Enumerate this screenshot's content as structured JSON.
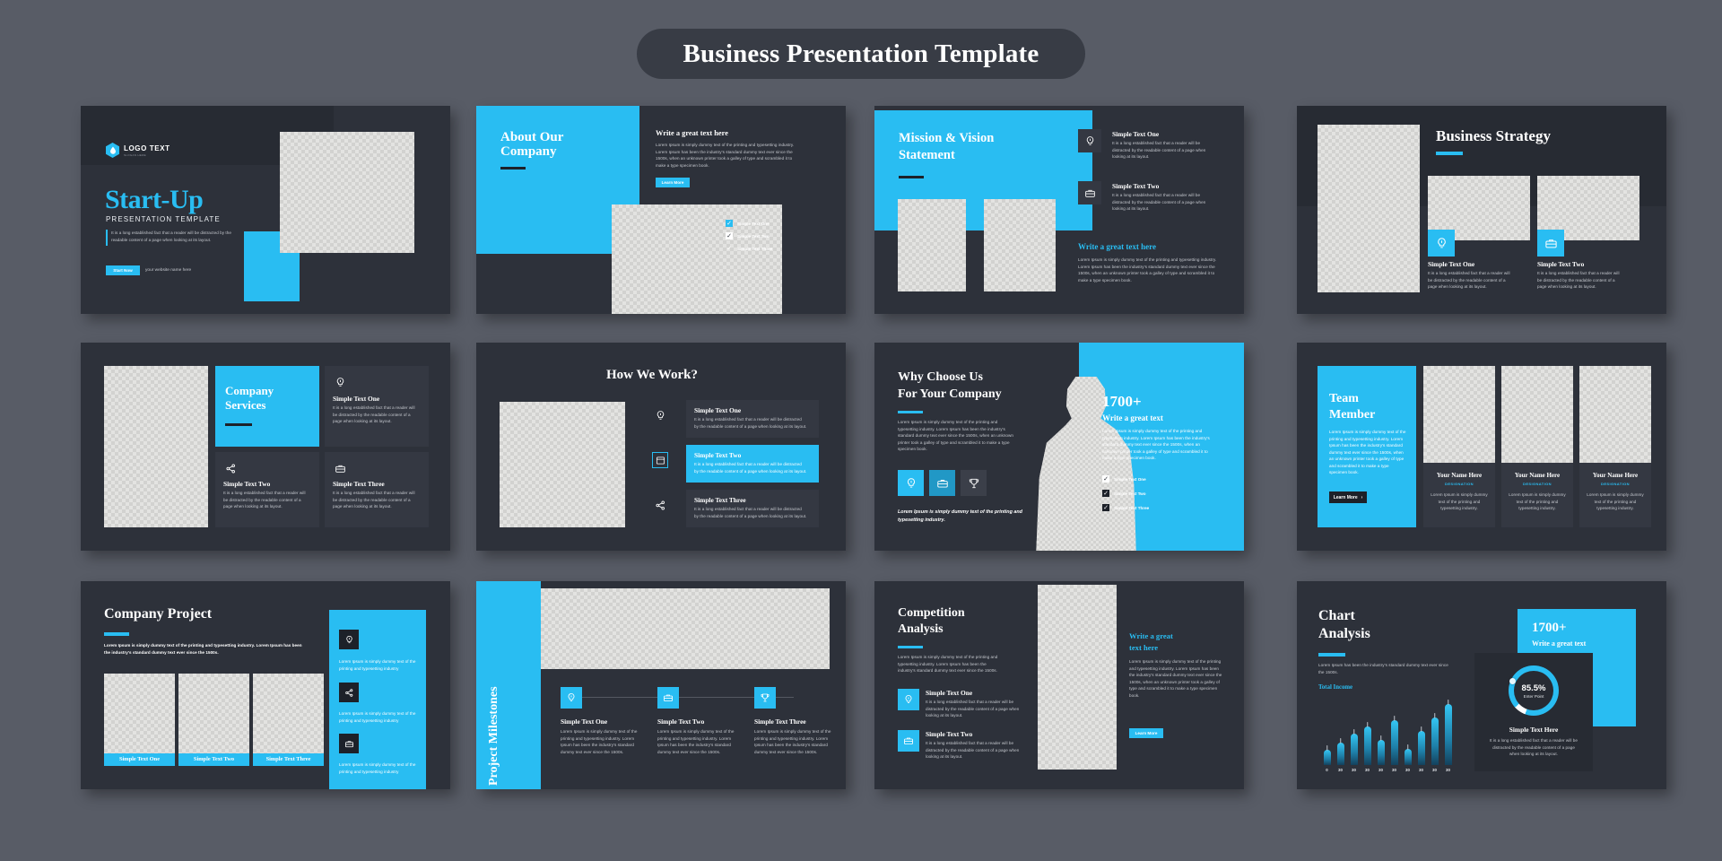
{
  "header": {
    "title": "Business Presentation Template"
  },
  "theme": {
    "accent": "#29bdf2",
    "slide_bg": "#2d313a",
    "page_bg": "#585c66",
    "panel": "#343842",
    "dark": "#1d2129"
  },
  "common": {
    "body_short": "It is a long established fact that a reader will be distracted by the readable content of a page when looking at its layout.",
    "lorem_long": "Lorem Ipsum is simply dummy text of the printing and typesetting industry. Lorem Ipsum has been the industry's standard dummy text ever since the 1500s, when an unknown printer took a galley of type and scrambled it to make a type specimen book.",
    "lorem_med": "Lorem Ipsum is simply dummy text of the printing and typesetting industry. Lorem Ipsum has been the industry's standard dummy text ever since the 1500s.",
    "lorem_tiny": "Lorem Ipsum is simply dummy text of the printing and typesetting industry.",
    "lorem_card": "Lorem Ipsum is simply dummy text of the printing and typesetting industry."
  },
  "slides": [
    {
      "id": "start-up",
      "logo_text": "LOGO TEXT",
      "logo_sub": "SLOGAN HERE",
      "title": "Start-Up",
      "subtitle": "PRESENTATION TEMPLATE",
      "body": "It is a long established fact that a reader will be distracted by the readable content of a page when looking at its layout.",
      "button": "Start Now",
      "website": "your website name here"
    },
    {
      "id": "about-our-company",
      "title_line1": "About Our",
      "title_line2": "Company",
      "right_title": "Write a great text here",
      "right_body": "Lorem Ipsum is simply dummy text of the printing and typesetting industry. Lorem Ipsum has been the industry's standard dummy text ever since the 1500s, when an unknown printer took a galley of type and scrambled it to make a type specimen book.",
      "button": "Learn More",
      "checks": [
        {
          "label": "Simple Text One",
          "state": "accent"
        },
        {
          "label": "Simple Text Two",
          "state": "white"
        },
        {
          "label": "Simple Text Three",
          "state": "plain"
        }
      ]
    },
    {
      "id": "mission-vision",
      "title_line1": "Mission & Vision",
      "title_line2": "Statement",
      "items": [
        {
          "icon": "lightbulb-icon",
          "heading": "Simple Text One",
          "body": "It is a long established fact that a reader will be distracted by the readable content of a page when looking at its layout."
        },
        {
          "icon": "briefcase-icon",
          "heading": "Simple Text Two",
          "body": "It is a long established fact that a reader will be distracted by the readable content of a page when looking at its layout."
        }
      ],
      "bottom_title": "Write a great text here",
      "bottom_body": "Lorem Ipsum is simply dummy text of the printing and typesetting industry. Lorem Ipsum has been the industry's standard dummy text ever since the 1500s, when an unknown printer took a galley of type and scrambled it to make a type specimen book."
    },
    {
      "id": "business-strategy",
      "title": "Business Strategy",
      "cards": [
        {
          "icon": "lightbulb-icon",
          "heading": "Simple Text One",
          "body": "It is a long established fact that a reader will be distracted by the readable content of a page when looking at its layout."
        },
        {
          "icon": "briefcase-icon",
          "heading": "Simple Text Two",
          "body": "It is a long established fact that a reader will be distracted by the readable content of a page when looking at its layout."
        }
      ]
    },
    {
      "id": "company-services",
      "title_line1": "Company",
      "title_line2": "Services",
      "cards": [
        {
          "icon": "lightbulb-icon",
          "heading": "Simple Text One",
          "body": "It is a long established fact that a reader will be distracted by the readable content of a page when looking at its layout."
        },
        {
          "icon": "share-icon",
          "heading": "Simple Text Two",
          "body": "It is a long established fact that a reader will be distracted by the readable content of a page when looking at its layout."
        },
        {
          "icon": "briefcase-icon",
          "heading": "Simple Text Three",
          "body": "It is a long established fact that a reader will be distracted by the readable content of a page when looking at its layout."
        }
      ]
    },
    {
      "id": "how-we-work",
      "title": "How We Work?",
      "steps": [
        {
          "icon": "lightbulb-icon",
          "heading": "Simple Text One",
          "body": "It is a long established fact that a reader will be distracted by the readable content of a page when looking at its layout.",
          "active": false
        },
        {
          "icon": "browser-icon",
          "heading": "Simple Text Two",
          "body": "It is a long established fact that a reader will be distracted by the readable content of a page when looking at its layout.",
          "active": true
        },
        {
          "icon": "share-icon",
          "heading": "Simple Text Three",
          "body": "It is a long established fact that a reader will be distracted by the readable content of a page when looking at its layout.",
          "active": false
        }
      ]
    },
    {
      "id": "why-choose-us",
      "title_line1": "Why Choose Us",
      "title_line2": "For Your Company",
      "body": "Lorem Ipsum is simply dummy text of the printing and typesetting industry. Lorem Ipsum has been the industry's standard dummy text ever since the 1500s, when an unknown printer took a galley of type and scrambled it to make a type specimen book.",
      "icons": [
        "lightbulb-icon",
        "briefcase-icon",
        "trophy-icon"
      ],
      "quote": "Lorem Ipsum is simply dummy text of the printing and typesetting industry.",
      "stat_number": "1700+",
      "stat_title": "Write a great text",
      "stat_body": "Lorem Ipsum is simply dummy text of the printing and typesetting industry. Lorem Ipsum has been the industry's standard dummy text ever since the 1500s, when an unknown printer took a galley of type and scrambled it to make a type specimen book.",
      "checks": [
        {
          "label": "Simple Text One",
          "state": "white"
        },
        {
          "label": "Simple Text Two",
          "state": "dark"
        },
        {
          "label": "Simple Text Three",
          "state": "dark"
        }
      ]
    },
    {
      "id": "team-member",
      "title_line1": "Team",
      "title_line2": "Member",
      "body": "Lorem Ipsum is simply dummy text of the printing and typesetting industry. Lorem Ipsum has been the industry's standard dummy text ever since the 1500s, when an unknown printer took a galley of type and scrambled it to make a type specimen book.",
      "button": "Learn More",
      "members": [
        {
          "name": "Your Name Here",
          "designation": "DESIGNATION",
          "body": "Lorem Ipsum is simply dummy text of the printing and typesetting industry."
        },
        {
          "name": "Your Name Here",
          "designation": "DESIGNATION",
          "body": "Lorem Ipsum is simply dummy text of the printing and typesetting industry."
        },
        {
          "name": "Your Name Here",
          "designation": "DESIGNATION",
          "body": "Lorem Ipsum is simply dummy text of the printing and typesetting industry."
        }
      ]
    },
    {
      "id": "company-project",
      "title": "Company Project",
      "body": "Lorem Ipsum is simply dummy text of the printing and typesetting industry. Lorem Ipsum has been the industry's standard dummy text ever since the 1500s.",
      "captions": [
        "Simple Text One",
        "Simple Text Two",
        "Simple Text Three"
      ],
      "side_items": [
        {
          "icon": "lightbulb-icon",
          "body": "Lorem Ipsum is simply dummy text of the printing and typesetting industry"
        },
        {
          "icon": "share-icon",
          "body": "Lorem Ipsum is simply dummy text of the printing and typesetting industry"
        },
        {
          "icon": "briefcase-icon",
          "body": "Lorem Ipsum is simply dummy text of the printing and typesetting industry"
        }
      ]
    },
    {
      "id": "project-milestones",
      "title": "Project Milestones",
      "steps": [
        {
          "icon": "lightbulb-icon",
          "heading": "Simple Text One",
          "body": "Lorem Ipsum is simply dummy text of the printing and typesetting industry. Lorem Ipsum has been the industry's standard dummy text ever since the 1500s."
        },
        {
          "icon": "briefcase-icon",
          "heading": "Simple Text Two",
          "body": "Lorem Ipsum is simply dummy text of the printing and typesetting industry. Lorem Ipsum has been the industry's standard dummy text ever since the 1500s."
        },
        {
          "icon": "trophy-icon",
          "heading": "Simple Text Three",
          "body": "Lorem Ipsum is simply dummy text of the printing and typesetting industry. Lorem Ipsum has been the industry's standard dummy text ever since the 1500s."
        }
      ]
    },
    {
      "id": "competition-analysis",
      "title_line1": "Competition",
      "title_line2": "Analysis",
      "body": "Lorem Ipsum is simply dummy text of the printing and typesetting industry. Lorem Ipsum has been the industry's standard dummy text ever since the 1500s.",
      "items": [
        {
          "icon": "lightbulb-icon",
          "heading": "Simple Text One",
          "body": "It is a long established fact that a reader will be distracted by the readable content of a page when looking at its layout."
        },
        {
          "icon": "briefcase-icon",
          "heading": "Simple Text Two",
          "body": "It is a long established fact that a reader will be distracted by the readable content of a page when looking at its layout."
        }
      ],
      "right_title_line1": "Write a great",
      "right_title_line2": "text here",
      "right_body": "Lorem Ipsum is simply dummy text of the printing and typesetting industry. Lorem Ipsum has been the industry's standard dummy text ever since the 1500s, when an unknown printer took a galley of type and scrambled it to make a type specimen book.",
      "button": "Learn More"
    },
    {
      "id": "chart-analysis",
      "title_line1": "Chart",
      "title_line2": "Analysis",
      "body": "Lorem Ipsum has been the industry's standard dummy text ever since the 1500s.",
      "legend": "Total Income",
      "stat_number": "1700+",
      "stat_title": "Write a great text",
      "donut_value": "85.5%",
      "donut_caption": "Enter Point",
      "card_heading": "Simple Text Here",
      "card_body": "It is a long established fact that a reader will be distracted by the readable content of a page when looking at its layout."
    }
  ],
  "chart_data": {
    "type": "bar",
    "title": "Total Income",
    "categories": [
      "0",
      "30",
      "30",
      "30",
      "30",
      "30",
      "30",
      "30",
      "30",
      "30"
    ],
    "values": [
      20,
      30,
      42,
      52,
      34,
      60,
      22,
      46,
      64,
      82
    ],
    "xlabel": "",
    "ylabel": "",
    "ylim": [
      0,
      90
    ],
    "grid": false,
    "legend_position": "top-left",
    "donut": {
      "type": "pie",
      "value": 85.5,
      "label": "Enter Point",
      "unit": "%"
    }
  }
}
